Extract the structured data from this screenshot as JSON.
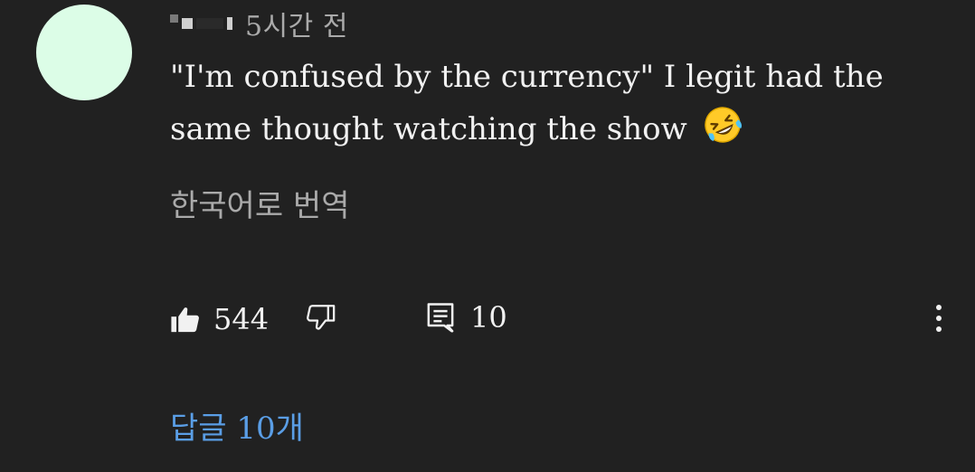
{
  "comment": {
    "timestamp": "5시간 전",
    "text": "\"I'm confused by the currency\" I legit had the same thought watching the show",
    "emoji": "rolling-on-the-floor-laughing",
    "translate_label": "한국어로 번역",
    "like_count": "544",
    "reply_count": "10",
    "replies_link": "답글 10개"
  },
  "colors": {
    "background": "#212121",
    "avatar": "#dcfde7",
    "text": "#f1f1f1",
    "muted": "#aaaaaa",
    "link": "#5a9ee6"
  },
  "icons": [
    "thumbs-up-icon",
    "thumbs-down-icon",
    "reply-icon",
    "more-vert-icon"
  ]
}
